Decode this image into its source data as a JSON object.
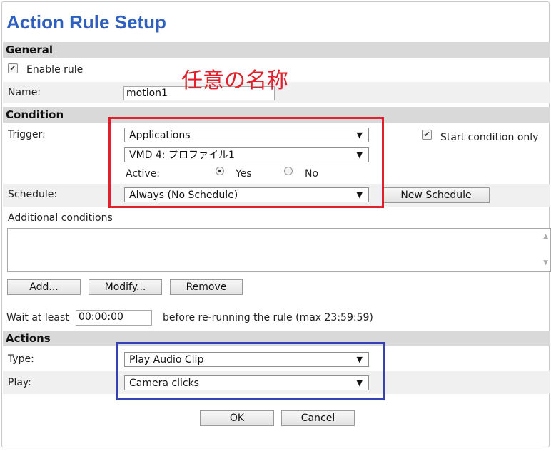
{
  "page": {
    "title": "Action Rule Setup"
  },
  "annotation": {
    "text": "任意の名称",
    "color": "#e0202a"
  },
  "general": {
    "header": "General",
    "enable_rule_label": "Enable rule",
    "enable_rule_checked": true,
    "name_label": "Name:",
    "name_value": "motion1"
  },
  "condition": {
    "header": "Condition",
    "trigger_label": "Trigger:",
    "trigger_value": "Applications",
    "subtrigger_value": "VMD 4: プロファイル1",
    "start_condition_label": "Start condition only",
    "start_condition_checked": true,
    "active_label": "Active:",
    "active_yes": "Yes",
    "active_no": "No",
    "active_selected": "Yes",
    "schedule_label": "Schedule:",
    "schedule_value": "Always (No Schedule)",
    "new_schedule_button": "New Schedule",
    "additional_label": "Additional conditions",
    "add_button": "Add...",
    "modify_button": "Modify...",
    "remove_button": "Remove",
    "wait_label": "Wait at least",
    "wait_value": "00:00:00",
    "wait_suffix": "before re-running the rule (max 23:59:59)"
  },
  "actions": {
    "header": "Actions",
    "type_label": "Type:",
    "type_value": "Play Audio Clip",
    "play_label": "Play:",
    "play_value": "Camera clicks"
  },
  "footer": {
    "ok_button": "OK",
    "cancel_button": "Cancel"
  },
  "colors": {
    "title": "#2f5fbf",
    "section_bg": "#d9d9d9",
    "red_highlight": "#e0202a",
    "blue_highlight": "#3343b6"
  }
}
